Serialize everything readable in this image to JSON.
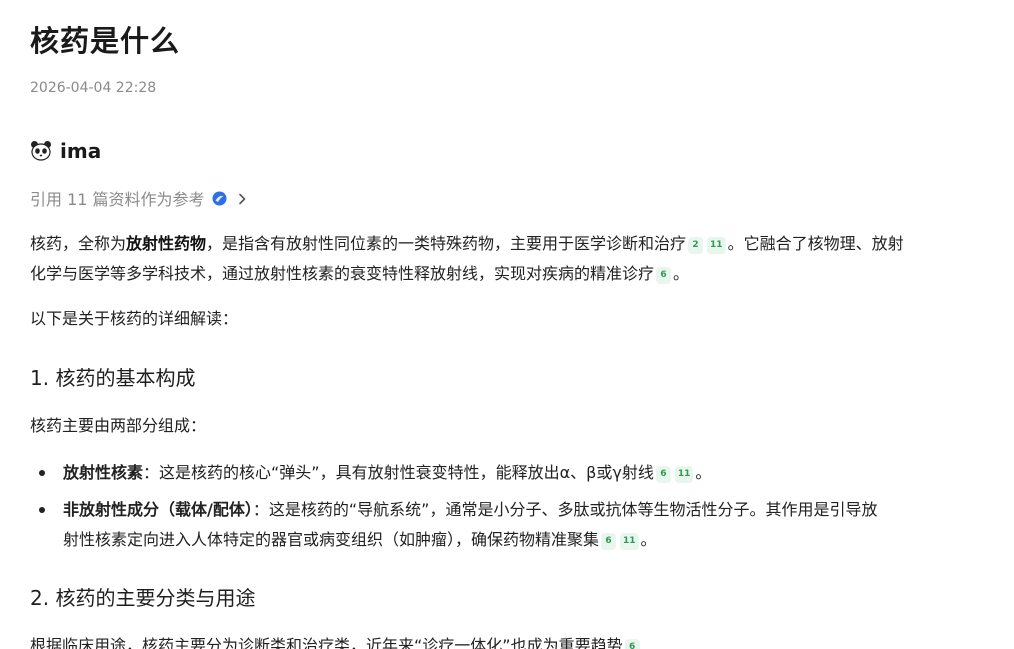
{
  "header": {
    "title": "核药是什么",
    "timestamp": "2026-04-04 22:28"
  },
  "author": {
    "name": "ima",
    "icon": "panda-icon"
  },
  "references": {
    "label": "引用 11 篇资料作为参考",
    "badge_icon": "verified-badge-icon",
    "chevron_icon": "chevron-right-icon"
  },
  "content": {
    "intro": {
      "t1": "核药，全称为",
      "b1": "放射性药物",
      "t2": "，是指含有放射性同位素的一类特殊药物，主要用于医学诊断和治疗",
      "c1": "2",
      "c2": "11",
      "t3": "。它融合了核物理、放射",
      "t4": "化学与医学等多学科技术，通过放射性核素的衰变特性释放射线，实现对疾病的精准诊疗",
      "c3": "6",
      "t5": "。"
    },
    "lead": "以下是关于核药的详细解读：",
    "section1": {
      "heading": "1. 核药的基本构成",
      "lead": "核药主要由两部分组成：",
      "items": [
        {
          "bold": "放射性核素",
          "text": "：这是核药的核心“弹头”，具有放射性衰变特性，能释放出α、β或γ射线",
          "cites": [
            "6",
            "11"
          ],
          "end": "。"
        },
        {
          "bold": "非放射性成分（载体/配体）",
          "text": "：这是核药的“导航系统”，通常是小分子、多肽或抗体等生物活性分子。其作用是引导放",
          "text2": "射性核素定向进入人体特定的器官或病变组织（如肿瘤），确保药物精准聚集",
          "cites": [
            "6",
            "11"
          ],
          "end": "。"
        }
      ]
    },
    "section2": {
      "heading": "2. 核药的主要分类与用途",
      "lead": "根据临床用途，核药主要分为诊断类和治疗类，近年来“诊疗一体化”也成为重要趋势",
      "cite": "6"
    }
  },
  "colors": {
    "accent_citation_bg": "#e9f6ee",
    "accent_citation_text": "#2e9b58",
    "badge_blue": "#2f6fe4",
    "muted_text": "#8a8a8a"
  }
}
